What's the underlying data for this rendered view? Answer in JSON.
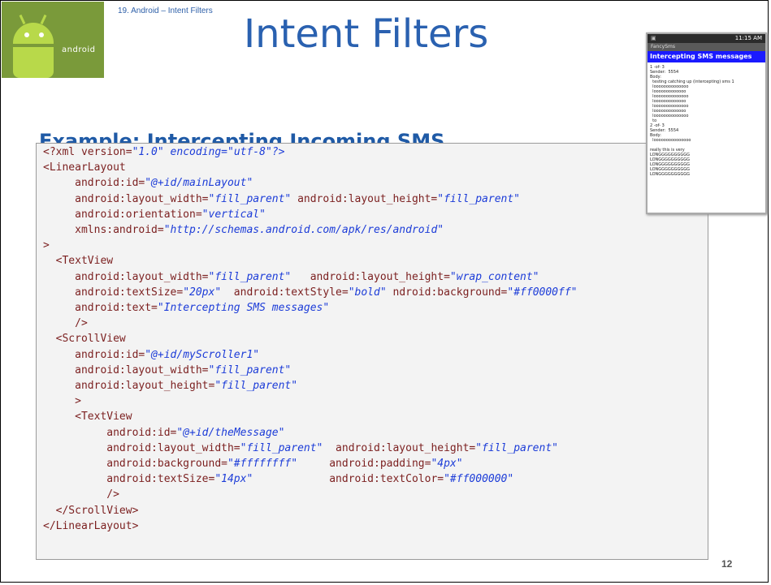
{
  "slide": {
    "breadcrumb": "19. Android – Intent Filters",
    "title": "Intent Filters",
    "subtitle": "Example: Intercepting Incoming SMS",
    "page_number": "12",
    "logo_text": "android"
  },
  "phone": {
    "status_time": "11:15 AM",
    "app_name": "FancySms",
    "header": "Intercepting SMS messages",
    "body": "1 -of- 3\nSender:  5554\nBody:\n  testing catching up (intercepting) sms 1\n  loooooooooooooo\n  looooooooooooo\n  loooooooooooooo\n  looooooooooooo\n  loooooooooooooo\n  looooooooooooo\n  loooooooooooooo\n  to\n2 -of- 3\nSender:  5554\nBody:\n  looooooooooooooo\n\nreally this is very\nLONGGGGGGGGGG\nLONGGGGGGGGGG\nLONGGGGGGGGGG\nLONGGGGGGGGGG\nLONGGGGGGGGGG"
  },
  "code": [
    [
      {
        "t": "<?xml version="
      },
      {
        "v": "\"1.0\""
      },
      {
        "t": " "
      },
      {
        "v": "encoding=\"utf-8\"?>"
      }
    ],
    [
      {
        "t": "<LinearLayout"
      }
    ],
    [
      {
        "t": "     android:id="
      },
      {
        "v": "\"@+id/mainLayout\""
      }
    ],
    [
      {
        "t": "     android:layout_width="
      },
      {
        "v": "\"fill_parent\""
      },
      {
        "t": " android:layout_height="
      },
      {
        "v": "\"fill_parent\""
      }
    ],
    [
      {
        "t": "     android:orientation="
      },
      {
        "v": "\"vertical\""
      }
    ],
    [
      {
        "t": "     xmlns:android="
      },
      {
        "v": "\"http://schemas.android.com/apk/res/android\""
      }
    ],
    [
      {
        "t": ">"
      }
    ],
    [
      {
        "t": "  <TextView"
      }
    ],
    [
      {
        "t": "     android:layout_width="
      },
      {
        "v": "\"fill_parent\""
      },
      {
        "t": "   android:layout_height="
      },
      {
        "v": "\"wrap_content\""
      }
    ],
    [
      {
        "t": "     android:textSize="
      },
      {
        "v": "\"20px\""
      },
      {
        "t": "  android:textStyle="
      },
      {
        "v": "\"bold\""
      },
      {
        "t": " ndroid:background="
      },
      {
        "v": "\"#ff0000ff\""
      }
    ],
    [
      {
        "t": "     android:text="
      },
      {
        "v": "\"Intercepting SMS messages\""
      }
    ],
    [
      {
        "t": "     />"
      }
    ],
    [
      {
        "t": "  <ScrollView"
      }
    ],
    [
      {
        "t": "     android:id="
      },
      {
        "v": "\"@+id/myScroller1\""
      }
    ],
    [
      {
        "t": "     android:layout_width="
      },
      {
        "v": "\"fill_parent\""
      }
    ],
    [
      {
        "t": "     android:layout_height="
      },
      {
        "v": "\"fill_parent\""
      }
    ],
    [
      {
        "t": "     >"
      }
    ],
    [
      {
        "t": "     <TextView"
      }
    ],
    [
      {
        "t": "          android:id="
      },
      {
        "v": "\"@+id/theMessage\""
      }
    ],
    [
      {
        "t": "          android:layout_width="
      },
      {
        "v": "\"fill_parent\""
      },
      {
        "t": "  android:layout_height="
      },
      {
        "v": "\"fill_parent\""
      }
    ],
    [
      {
        "t": "          android:background="
      },
      {
        "v": "\"#ffffffff\""
      },
      {
        "t": "     android:padding="
      },
      {
        "v": "\"4px\""
      }
    ],
    [
      {
        "t": "          android:textSize="
      },
      {
        "v": "\"14px\""
      },
      {
        "t": "            android:textColor="
      },
      {
        "v": "\"#ff000000\""
      }
    ],
    [
      {
        "t": "          />"
      }
    ],
    [
      {
        "t": "  </ScrollView>"
      }
    ],
    [
      {
        "t": "</LinearLayout>"
      }
    ]
  ],
  "colors": {
    "tag": "#7b1f1f",
    "value": "#1c3cd8",
    "title": "#2a61b0",
    "header_bar": "#1a1aff"
  }
}
